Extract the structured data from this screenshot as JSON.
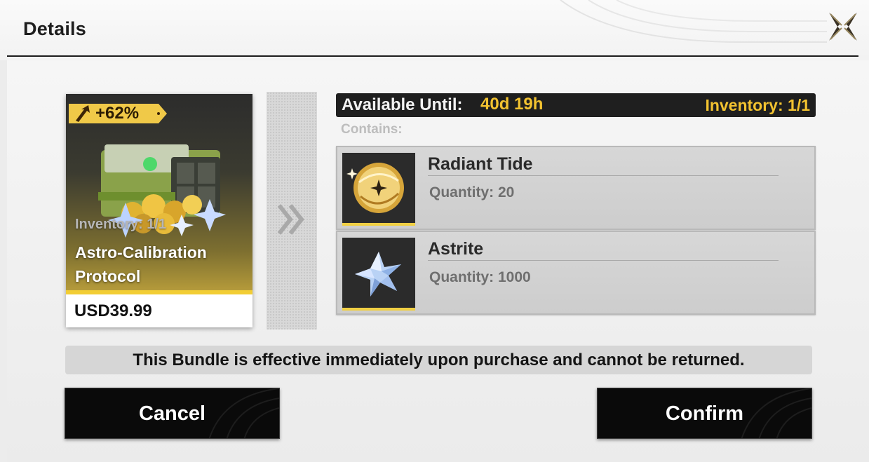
{
  "header": {
    "title": "Details",
    "close_icon": "close-icon"
  },
  "bundle": {
    "bonus": "+62%",
    "inventory": "Inventory: 1/1",
    "name": "Astro-Calibration Protocol",
    "price": "USD39.99"
  },
  "availability": {
    "label": "Available Until:",
    "value": "40d 19h",
    "inventory": "Inventory: 1/1"
  },
  "contains_label": "Contains:",
  "items": [
    {
      "name": "Radiant Tide",
      "quantity": "Quantity: 20",
      "icon": "radiant-tide-icon"
    },
    {
      "name": "Astrite",
      "quantity": "Quantity: 1000",
      "icon": "astrite-icon"
    }
  ],
  "notice": "This Bundle is effective immediately upon purchase and cannot be returned.",
  "buttons": {
    "cancel": "Cancel",
    "confirm": "Confirm"
  },
  "colors": {
    "accent_gold": "#f3c330",
    "dark": "#0a0a0a"
  }
}
